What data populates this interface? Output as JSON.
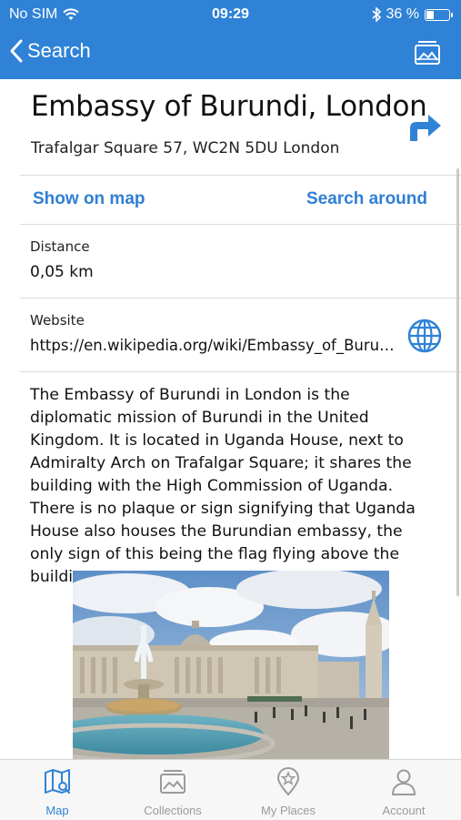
{
  "status": {
    "carrier": "No SIM",
    "time": "09:29",
    "battery": "36 %",
    "battery_level": 0.36
  },
  "nav": {
    "back_label": "Search",
    "gallery_icon": "gallery-icon"
  },
  "place": {
    "title": "Embassy of Burundi, London",
    "address": "Trafalgar Square 57, WC2N 5DU London"
  },
  "actions": {
    "show_on_map": "Show on map",
    "search_around": "Search around"
  },
  "distance": {
    "label": "Distance",
    "value": "0,05 km"
  },
  "website": {
    "label": "Website",
    "url": "https://en.wikipedia.org/wiki/Embassy_of_Burundi,_London"
  },
  "description": "The Embassy of Burundi in London is the diplomatic mission of Burundi in the United Kingdom. It is located in Uganda House, next to Admiralty Arch on Trafalgar Square; it shares the building with the High Commission of Uganda. There is no plaque or sign signifying that Uganda House also houses the Burundian embassy, the only sign of this being the flag flying above the building.",
  "tabs": [
    {
      "label": "Map",
      "icon": "map-icon",
      "active": true
    },
    {
      "label": "Collections",
      "icon": "collections-icon",
      "active": false
    },
    {
      "label": "My Places",
      "icon": "pin-icon",
      "active": false
    },
    {
      "label": "Account",
      "icon": "person-icon",
      "active": false
    }
  ],
  "colors": {
    "accent": "#2f82d6",
    "link": "#2f7fd4"
  }
}
